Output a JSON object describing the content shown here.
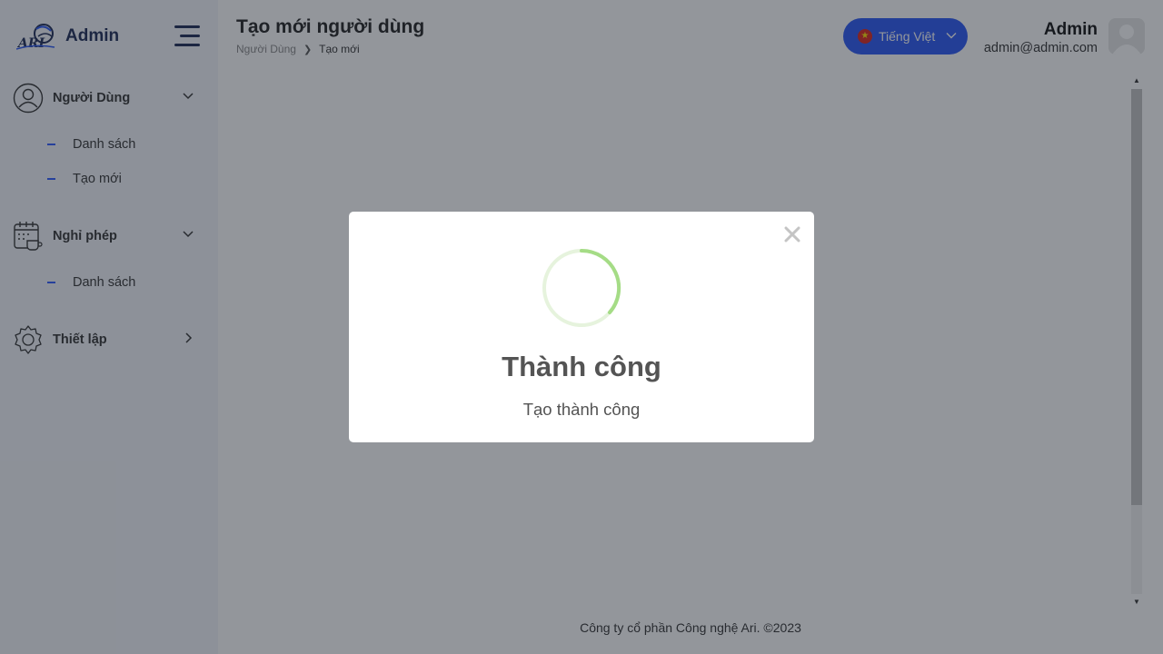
{
  "app": {
    "brand_name": "Admin"
  },
  "sidebar": {
    "groups": [
      {
        "label": "Người Dùng",
        "icon": "user-circle-icon",
        "expanded": true,
        "items": [
          {
            "label": "Danh sách"
          },
          {
            "label": "Tạo mới"
          }
        ]
      },
      {
        "label": "Nghỉ phép",
        "icon": "calendar-coffee-icon",
        "expanded": true,
        "items": [
          {
            "label": "Danh sách"
          }
        ]
      },
      {
        "label": "Thiết lập",
        "icon": "gear-icon",
        "expanded": false,
        "items": []
      }
    ]
  },
  "header": {
    "title": "Tạo mới người dùng",
    "breadcrumb": [
      "Người Dùng",
      "Tạo mới"
    ],
    "language": "Tiếng Việt",
    "user": {
      "name": "Admin",
      "email": "admin@admin.com"
    }
  },
  "footer": {
    "text": "Công ty cổ phần Công nghệ Ari. ©2023"
  },
  "modal": {
    "title": "Thành công",
    "message": "Tạo thành công",
    "icon": "success-spinner-icon"
  },
  "colors": {
    "accent": "#2a57f5",
    "sidebar_bg": "#f3f6fb",
    "success": "#a5dc86",
    "navy": "#1c2a55"
  }
}
